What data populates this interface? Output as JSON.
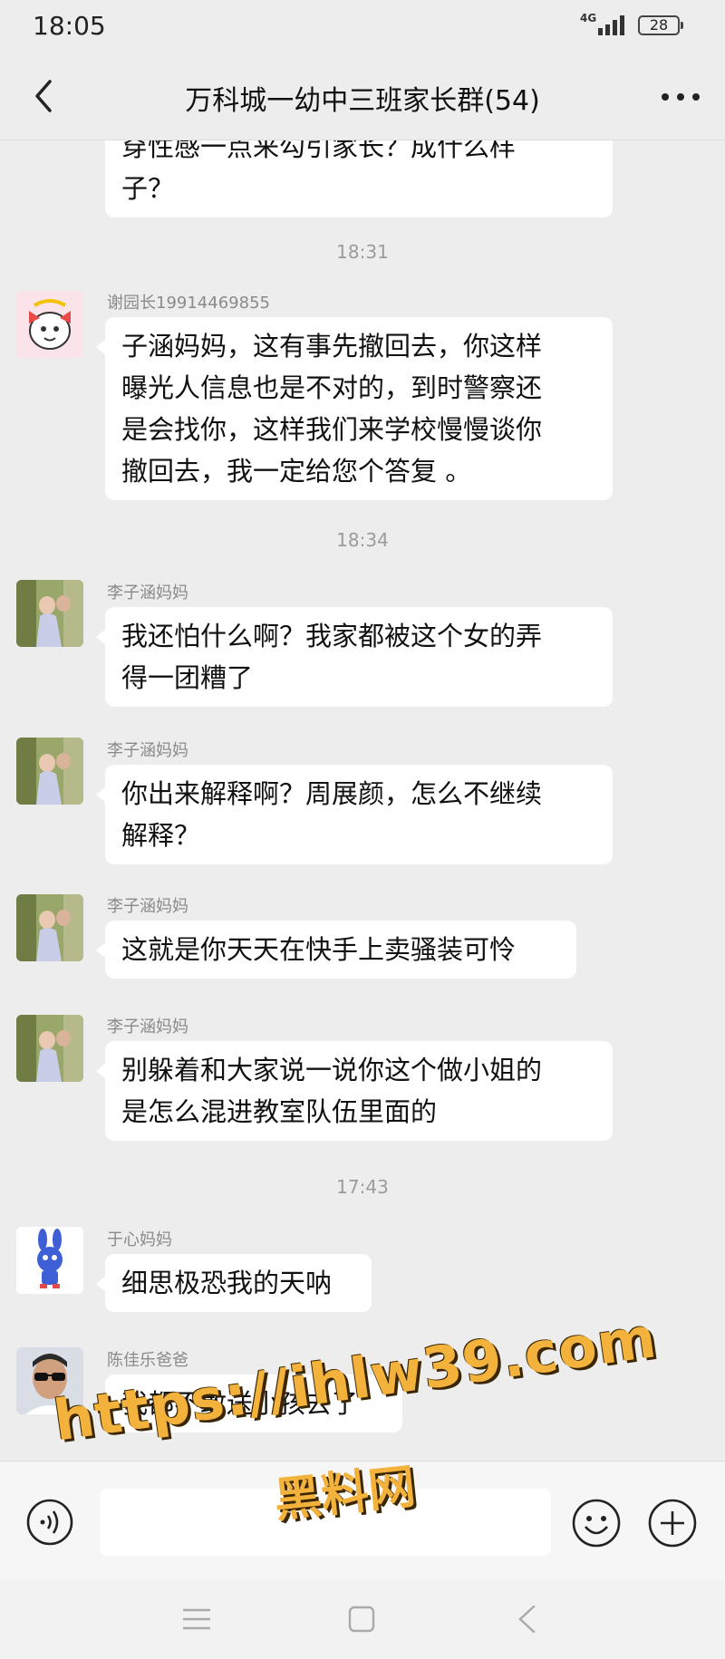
{
  "status_bar": {
    "time": "18:05",
    "network": "4G",
    "battery": "28"
  },
  "header": {
    "title": "万科城一幼中三班家长群(54)"
  },
  "messages": [
    {
      "text_lines": [
        "穿性感一点来勾引家长？成什么样",
        "子？"
      ]
    },
    {
      "time": "18:31"
    },
    {
      "sender": "谢园长19914469855",
      "text_lines": [
        "子涵妈妈，这有事先撤回去，你这样",
        "曝光人信息也是不对的，到时警察还",
        "是会找你，这样我们来学校慢慢谈你",
        "撤回去，我一定给您个答复 。"
      ]
    },
    {
      "time": "18:34"
    },
    {
      "sender": "李子涵妈妈",
      "text_lines": [
        "我还怕什么啊？我家都被这个女的弄",
        "得一团糟了"
      ]
    },
    {
      "sender": "李子涵妈妈",
      "text_lines": [
        "你出来解释啊？周展颜，怎么不继续",
        "解释？"
      ]
    },
    {
      "sender": "李子涵妈妈",
      "text_lines": [
        "这就是你天天在快手上卖骚装可怜"
      ]
    },
    {
      "sender": "李子涵妈妈",
      "text_lines": [
        "别躲着和大家说一说你这个做小姐的",
        "是怎么混进教室队伍里面的"
      ]
    },
    {
      "time": "17:43"
    },
    {
      "sender": "于心妈妈",
      "text_lines": [
        "细思极恐我的天呐"
      ]
    },
    {
      "sender": "陈佳乐爸爸",
      "text_lines": [
        "我都不敢送小孩去了"
      ]
    }
  ],
  "watermark": {
    "url": "https://ihlw39.com",
    "name": "黑料网"
  },
  "icons": {
    "back": "chevron-left-icon",
    "more": "more-dots-icon",
    "voice": "voice-icon",
    "emoji": "emoji-icon",
    "plus": "plus-icon",
    "nav_menu": "menu-icon",
    "nav_home": "home-icon",
    "nav_back": "back-icon"
  },
  "colors": {
    "background": "#ededed",
    "bubble": "#ffffff",
    "watermark": "#f2b23c"
  }
}
